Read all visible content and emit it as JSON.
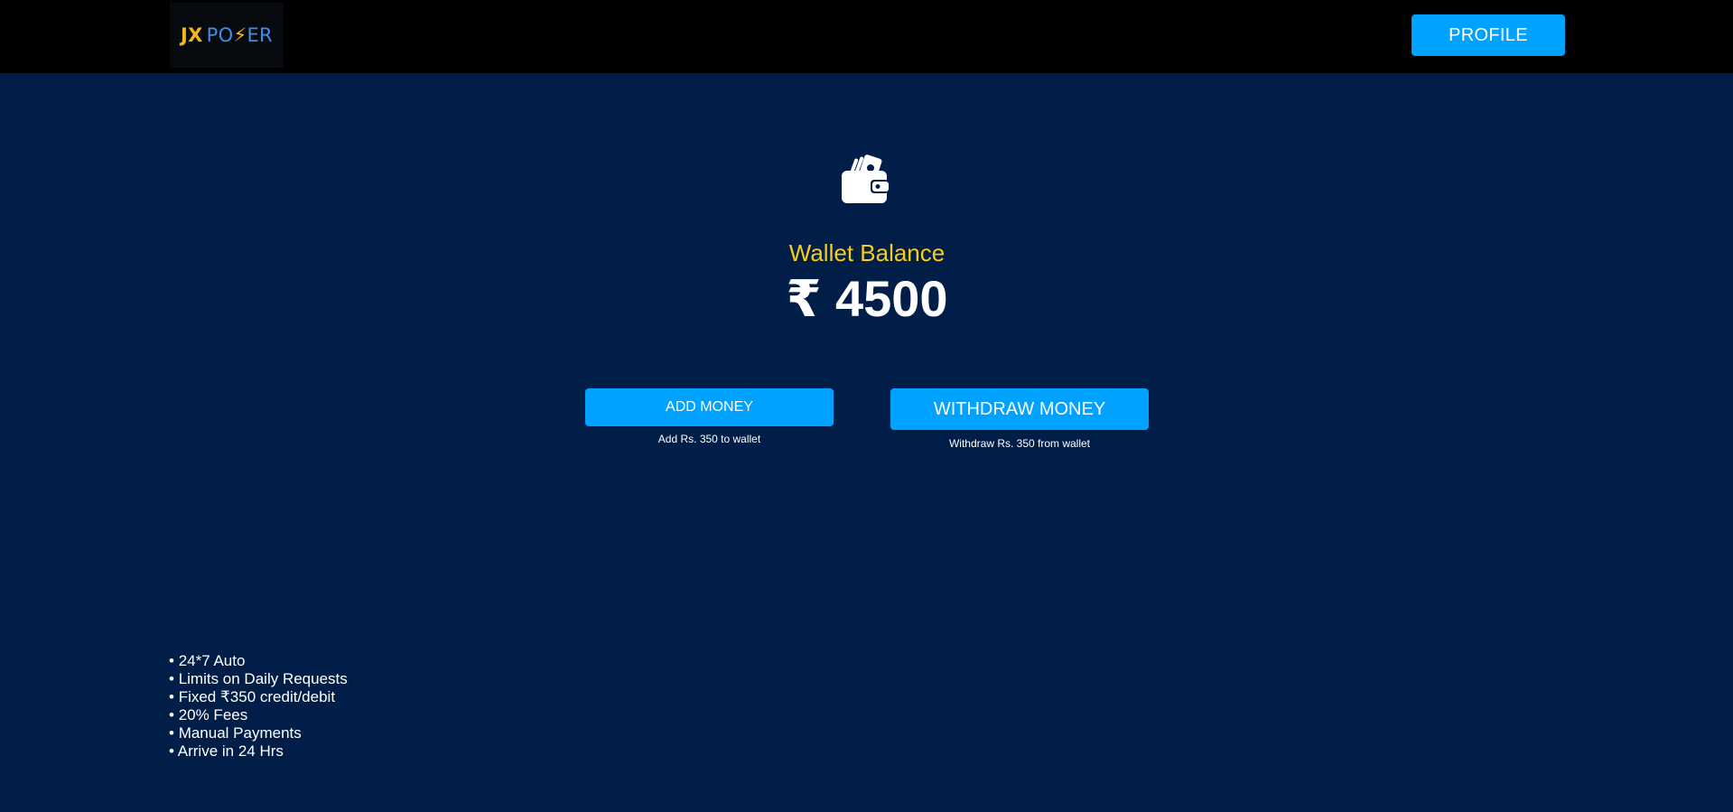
{
  "header": {
    "logo": {
      "part1": "JX",
      "part2a": "PO",
      "bolt": "⚡",
      "part2b": "ER"
    },
    "profile_label": "PROFILE"
  },
  "wallet": {
    "icon": "wallet-icon",
    "balance_label": "Wallet Balance",
    "balance_amount": "₹ 4500"
  },
  "actions": {
    "add_label": "ADD MONEY",
    "add_sub": "Add Rs. 350 to wallet",
    "withdraw_label": "WITHDRAW MONEY",
    "withdraw_sub": "Withdraw Rs. 350 from wallet"
  },
  "features": [
    "24*7 Auto",
    "Limits on Daily Requests",
    "Fixed ₹350 credit/debit",
    "20% Fees",
    "Manual Payments",
    "Arrive in 24 Hrs"
  ],
  "colors": {
    "background": "#001e47",
    "header": "#000000",
    "accent": "#00a2ff",
    "highlight": "#f6cd1c"
  }
}
